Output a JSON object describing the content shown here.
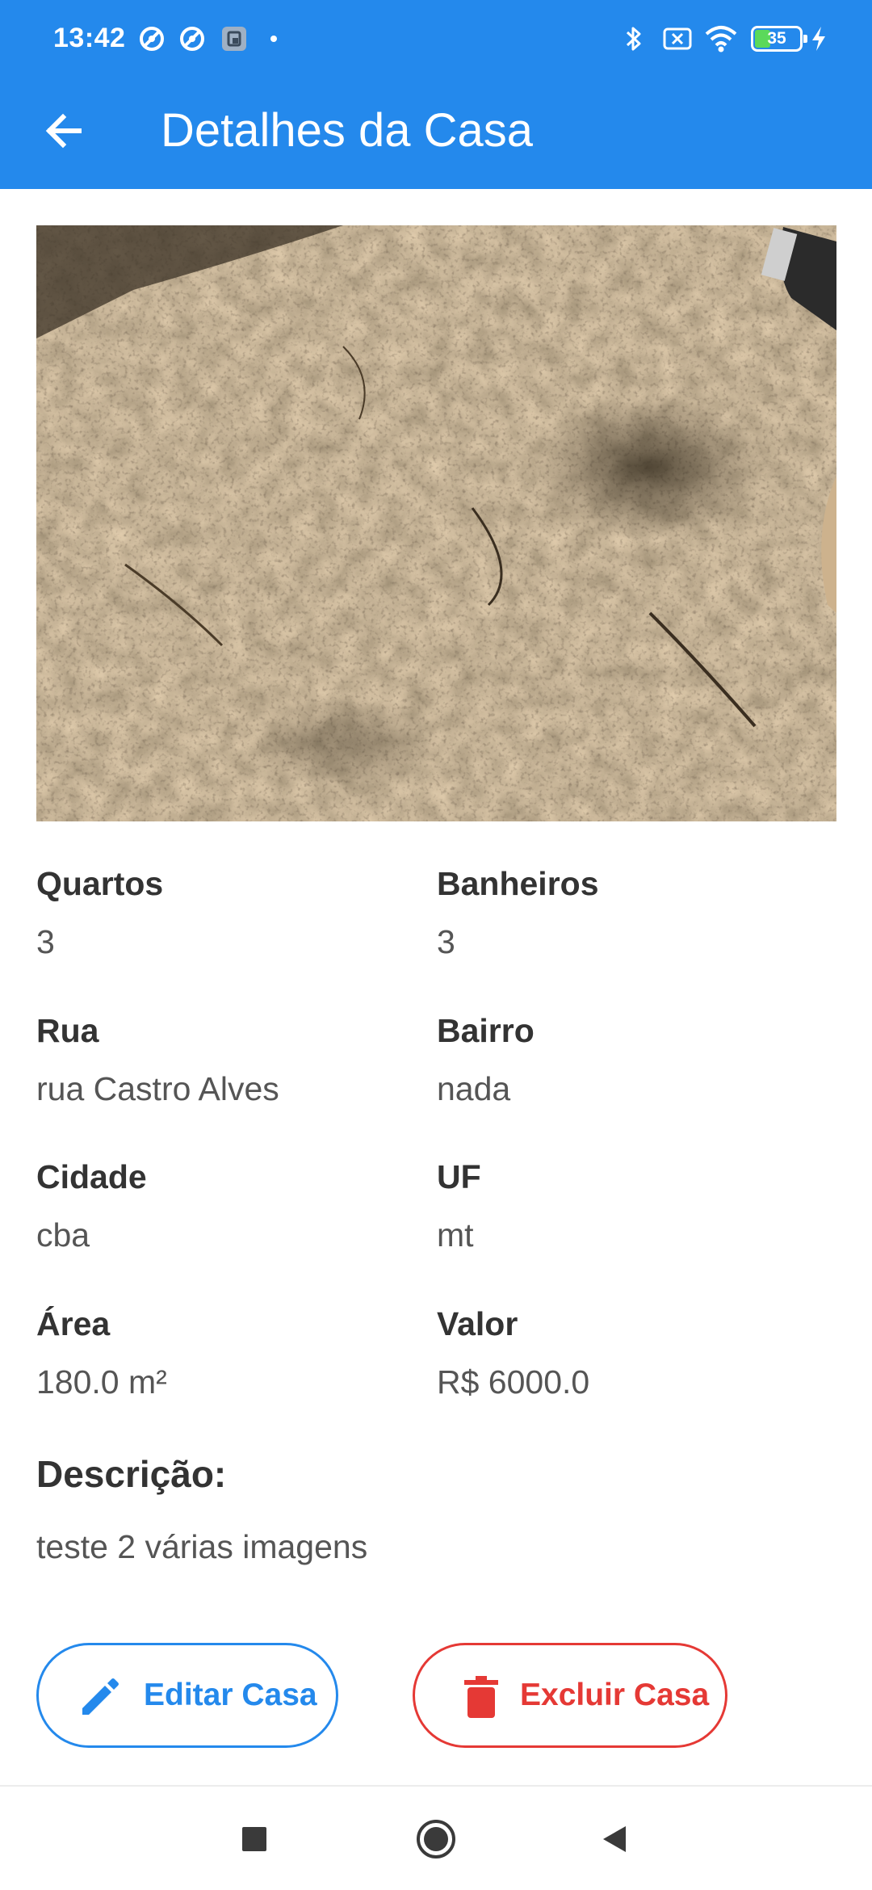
{
  "status_bar": {
    "time": "13:42",
    "battery_level": "35",
    "battery_fraction": 0.35,
    "icons": [
      "sync-icon",
      "sync-icon",
      "screenshot-icon",
      "bluetooth-icon",
      "no-sim-icon",
      "wifi-icon",
      "battery-icon",
      "charging-icon"
    ]
  },
  "app_bar": {
    "title": "Detalhes da Casa",
    "back_icon": "arrow-back-icon",
    "color": "#2489EC"
  },
  "house": {
    "fields": {
      "quartos": {
        "label": "Quartos",
        "value": "3"
      },
      "banheiros": {
        "label": "Banheiros",
        "value": "3"
      },
      "rua": {
        "label": "Rua",
        "value": "rua Castro Alves"
      },
      "bairro": {
        "label": "Bairro",
        "value": "nada"
      },
      "cidade": {
        "label": "Cidade",
        "value": "cba"
      },
      "uf": {
        "label": "UF",
        "value": "mt"
      },
      "area": {
        "label": "Área",
        "value": "180.0 m²"
      },
      "valor": {
        "label": "Valor",
        "value": "R$ 6000.0"
      }
    },
    "description": {
      "label": "Descrição:",
      "value": "teste 2 várias imagens"
    }
  },
  "actions": {
    "edit": {
      "label": "Editar Casa",
      "icon": "pencil-icon",
      "color": "#2489EC"
    },
    "delete": {
      "label": "Excluir Casa",
      "icon": "trash-icon",
      "color": "#E53935"
    }
  },
  "nav": {
    "icons": [
      "recent-apps-icon",
      "home-icon",
      "back-icon"
    ]
  }
}
